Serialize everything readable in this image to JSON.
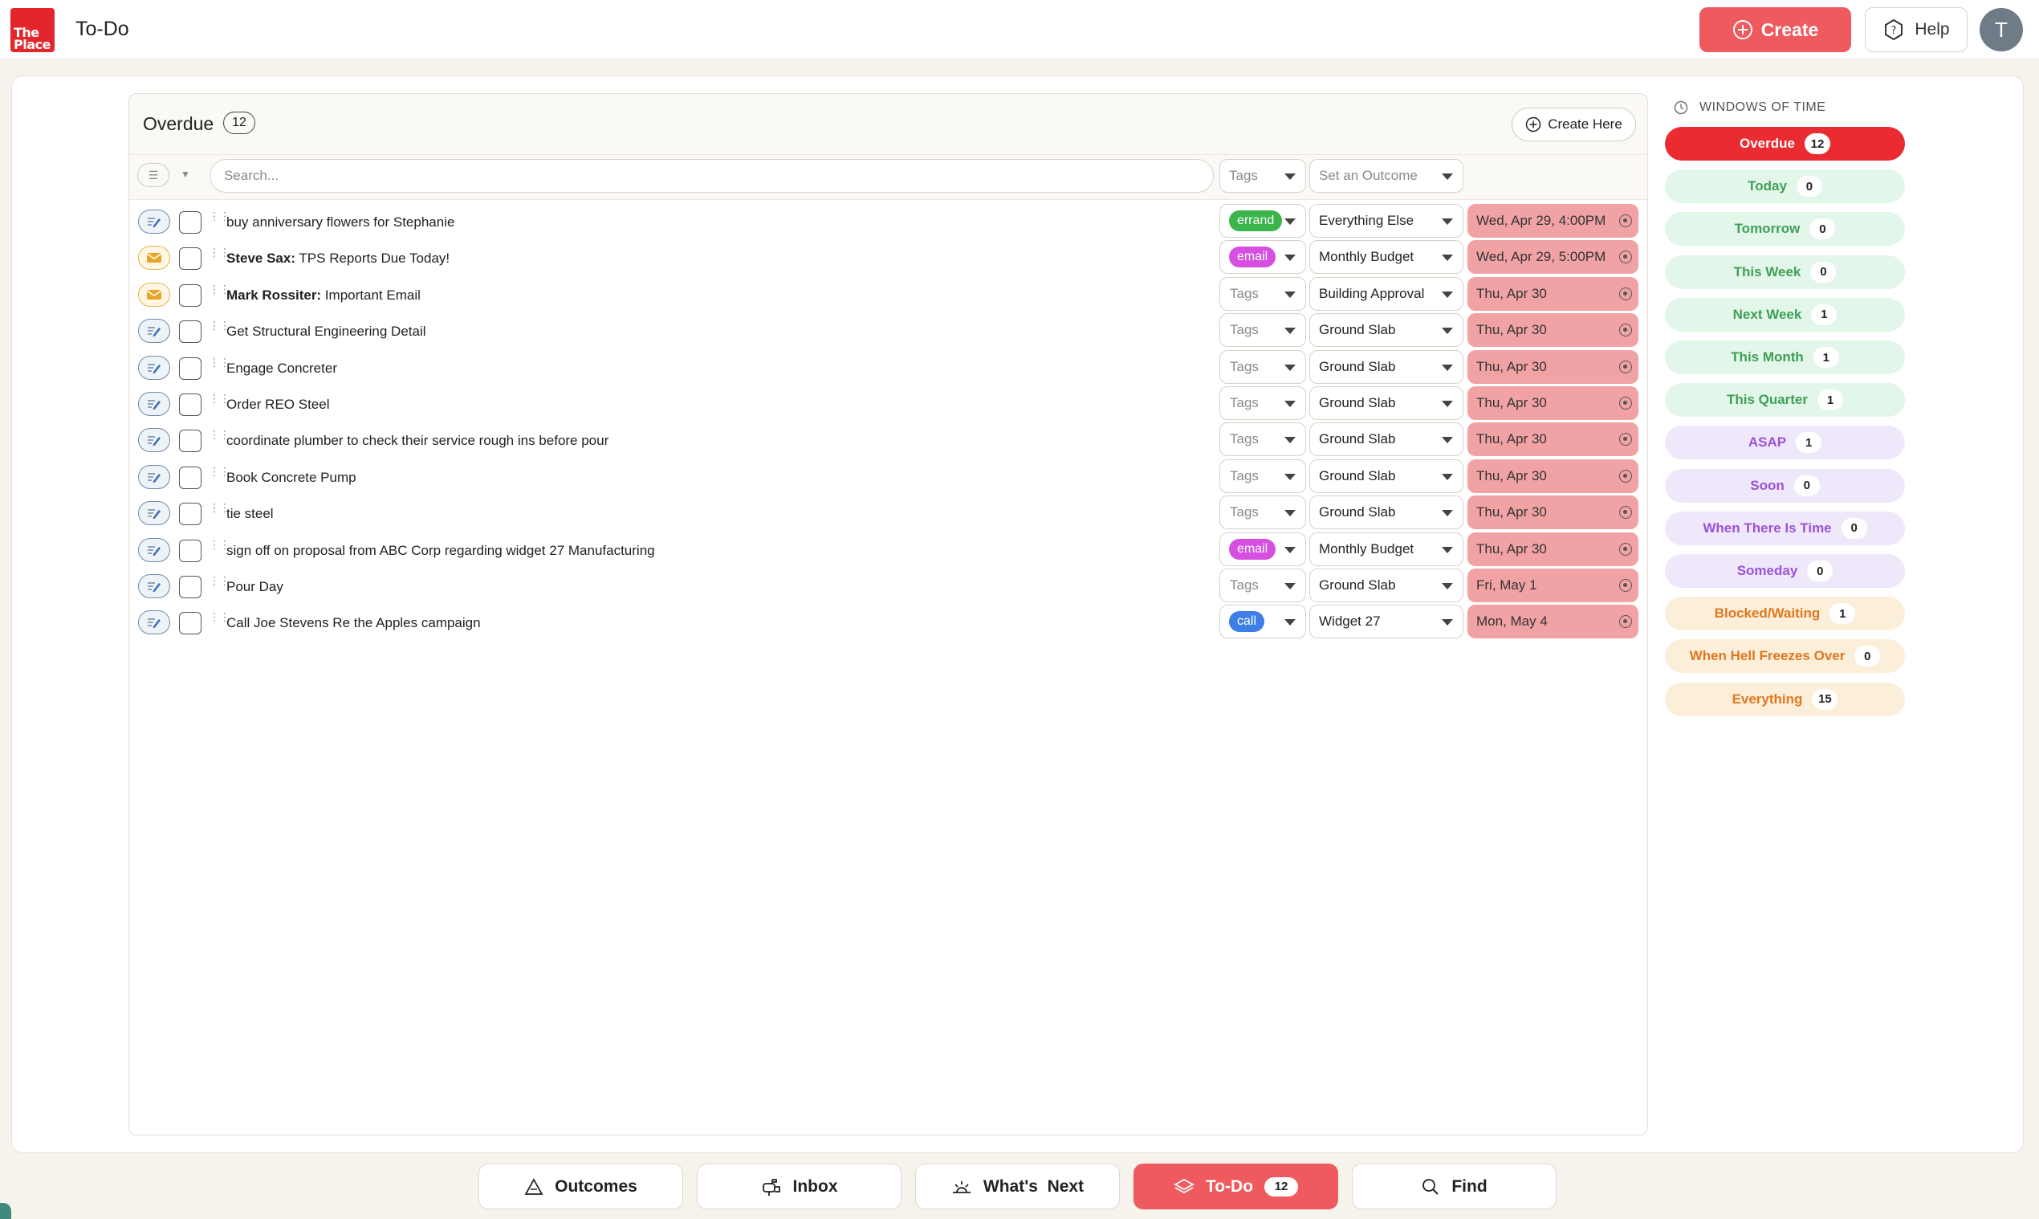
{
  "app": {
    "logo_text": "The Place",
    "title": "To-Do"
  },
  "header": {
    "create_label": "Create",
    "help_label": "Help",
    "avatar_initial": "T"
  },
  "panel": {
    "title": "Overdue",
    "count": "12",
    "create_here_label": "Create Here",
    "search_placeholder": "Search...",
    "tags_placeholder": "Tags",
    "outcome_placeholder": "Set an Outcome"
  },
  "tasks": [
    {
      "type": "task",
      "prefix": "",
      "text": "buy anniversary flowers for Stephanie",
      "tag": "errand",
      "tag_color": "#3bb54a",
      "outcome": "Everything Else",
      "date": "Wed, Apr 29, 4:00PM"
    },
    {
      "type": "mail",
      "prefix": "Steve Sax:",
      "text": " TPS Reports Due Today!",
      "tag": "email",
      "tag_color": "#d64fe0",
      "outcome": "Monthly Budget",
      "date": "Wed, Apr 29, 5:00PM"
    },
    {
      "type": "mail",
      "prefix": "Mark Rossiter:",
      "text": " Important Email",
      "tag": "",
      "tag_color": "",
      "outcome": "Building Approval",
      "date": "Thu, Apr 30"
    },
    {
      "type": "task",
      "prefix": "",
      "text": "Get Structural Engineering Detail",
      "tag": "",
      "tag_color": "",
      "outcome": "Ground Slab",
      "date": "Thu, Apr 30"
    },
    {
      "type": "task",
      "prefix": "",
      "text": "Engage Concreter",
      "tag": "",
      "tag_color": "",
      "outcome": "Ground Slab",
      "date": "Thu, Apr 30"
    },
    {
      "type": "task",
      "prefix": "",
      "text": "Order REO Steel",
      "tag": "",
      "tag_color": "",
      "outcome": "Ground Slab",
      "date": "Thu, Apr 30"
    },
    {
      "type": "task",
      "prefix": "",
      "text": "coordinate plumber to check their service rough ins before pour",
      "tag": "",
      "tag_color": "",
      "outcome": "Ground Slab",
      "date": "Thu, Apr 30"
    },
    {
      "type": "task",
      "prefix": "",
      "text": "Book Concrete Pump",
      "tag": "",
      "tag_color": "",
      "outcome": "Ground Slab",
      "date": "Thu, Apr 30"
    },
    {
      "type": "task",
      "prefix": "",
      "text": "tie steel",
      "tag": "",
      "tag_color": "",
      "outcome": "Ground Slab",
      "date": "Thu, Apr 30"
    },
    {
      "type": "task",
      "prefix": "",
      "text": "sign off on proposal from ABC Corp regarding widget 27 Manufacturing",
      "tag": "email",
      "tag_color": "#d64fe0",
      "outcome": "Monthly Budget",
      "date": "Thu, Apr 30"
    },
    {
      "type": "task",
      "prefix": "",
      "text": "Pour Day",
      "tag": "",
      "tag_color": "",
      "outcome": "Ground Slab",
      "date": "Fri, May 1"
    },
    {
      "type": "task",
      "prefix": "",
      "text": "Call Joe Stevens Re the Apples campaign",
      "tag": "call",
      "tag_color": "#3d7fe6",
      "outcome": "Widget 27",
      "date": "Mon, May 4"
    }
  ],
  "windows_of_time": {
    "heading": "WINDOWS OF TIME",
    "items": [
      {
        "label": "Overdue",
        "count": "12",
        "bg": "#ea2b32",
        "fg": "#ffffff"
      },
      {
        "label": "Today",
        "count": "0",
        "bg": "#e3f6ea",
        "fg": "#3e9f55"
      },
      {
        "label": "Tomorrow",
        "count": "0",
        "bg": "#e3f6ea",
        "fg": "#3e9f55"
      },
      {
        "label": "This Week",
        "count": "0",
        "bg": "#e3f6ea",
        "fg": "#3e9f55"
      },
      {
        "label": "Next Week",
        "count": "1",
        "bg": "#e3f6ea",
        "fg": "#3e9f55"
      },
      {
        "label": "This Month",
        "count": "1",
        "bg": "#e3f6ea",
        "fg": "#3e9f55"
      },
      {
        "label": "This Quarter",
        "count": "1",
        "bg": "#e3f6ea",
        "fg": "#3e9f55"
      },
      {
        "label": "ASAP",
        "count": "1",
        "bg": "#efe8fb",
        "fg": "#9b52d8"
      },
      {
        "label": "Soon",
        "count": "0",
        "bg": "#efe8fb",
        "fg": "#9b52d8"
      },
      {
        "label": "When There Is Time",
        "count": "0",
        "bg": "#efe8fb",
        "fg": "#9b52d8"
      },
      {
        "label": "Someday",
        "count": "0",
        "bg": "#efe8fb",
        "fg": "#9b52d8"
      },
      {
        "label": "Blocked/Waiting",
        "count": "1",
        "bg": "#fcefd9",
        "fg": "#e2761f"
      },
      {
        "label": "When Hell Freezes Over",
        "count": "0",
        "bg": "#fcefd9",
        "fg": "#e2761f"
      },
      {
        "label": "Everything",
        "count": "15",
        "bg": "#fcefd9",
        "fg": "#e2761f"
      }
    ]
  },
  "bottom_nav": [
    {
      "label": "Outcomes",
      "icon": "triangle-icon",
      "count": ""
    },
    {
      "label": "Inbox",
      "icon": "mailbox-icon",
      "count": ""
    },
    {
      "label": "What's  Next",
      "icon": "sunrise-icon",
      "count": ""
    },
    {
      "label": "To-Do",
      "icon": "layers-icon",
      "count": "12",
      "active": true
    },
    {
      "label": "Find",
      "icon": "search-icon",
      "count": ""
    }
  ]
}
